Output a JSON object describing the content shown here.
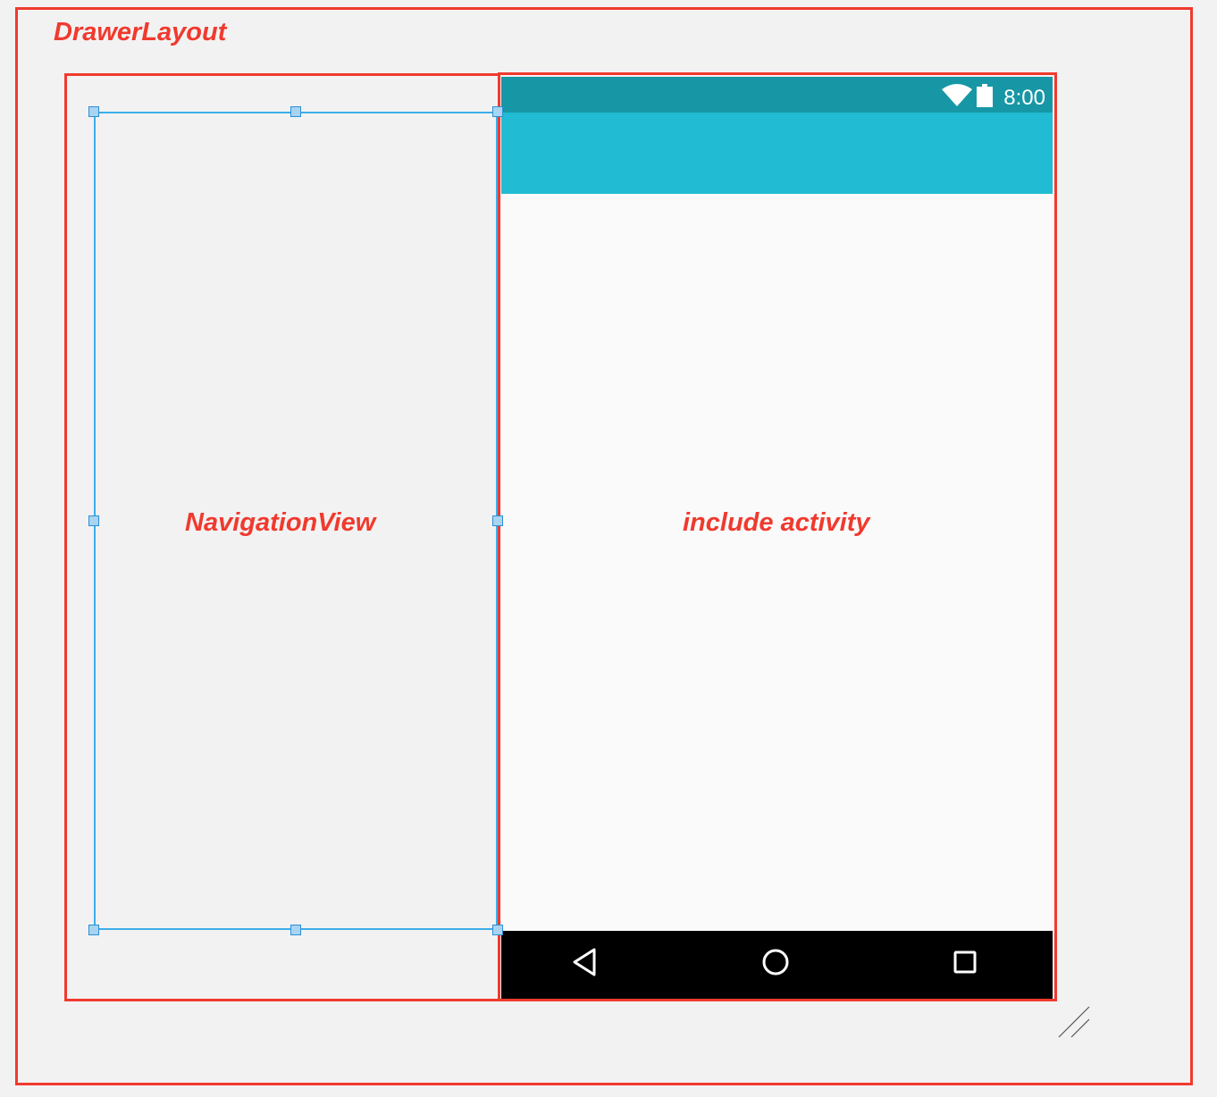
{
  "labels": {
    "drawer_layout": "DrawerLayout",
    "navigation_view": "NavigationView",
    "include_activity": "include activity"
  },
  "status_bar": {
    "time": "8:00",
    "icons": [
      "wifi-icon",
      "battery-icon"
    ]
  },
  "nav_bar": {
    "icons": [
      "back-icon",
      "home-icon",
      "recents-icon"
    ]
  },
  "colors": {
    "annotation": "#f03a2e",
    "status_bar": "#1797a6",
    "app_bar": "#21bcd3",
    "selection": "#3daee9",
    "background": "#f2f2f2"
  }
}
